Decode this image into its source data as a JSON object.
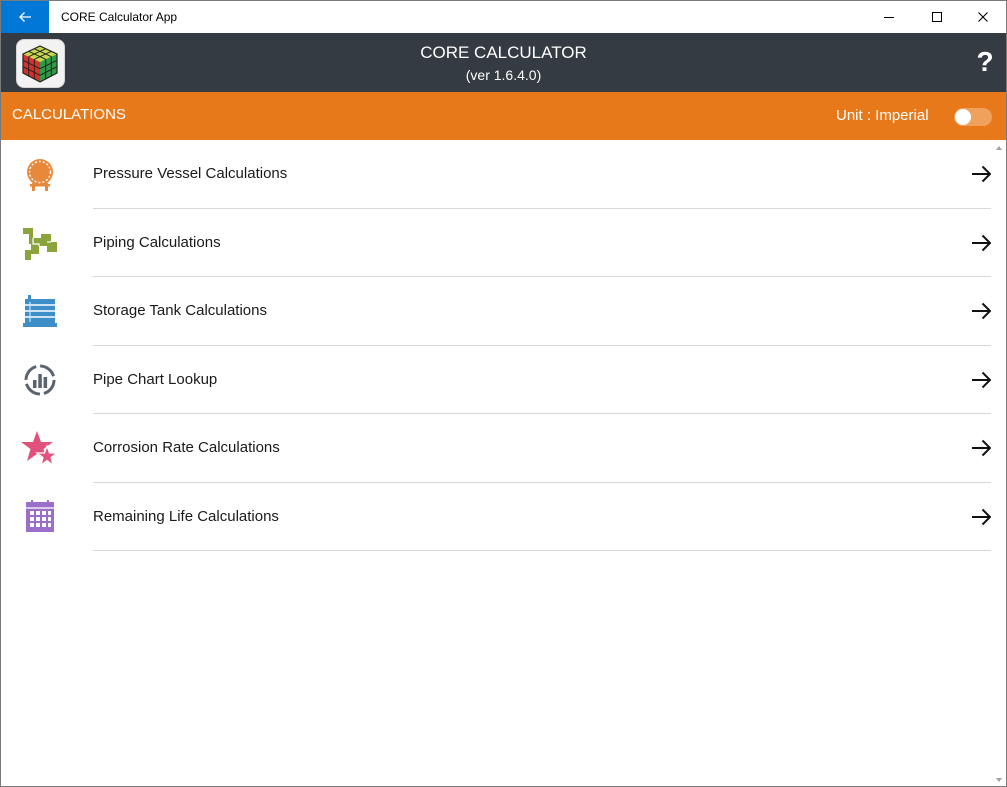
{
  "window": {
    "title": "CORE Calculator App",
    "icons": {
      "back": "back-arrow-icon",
      "minimize": "minimize-icon",
      "maximize": "maximize-icon",
      "close": "close-icon"
    },
    "accent_color": "#0078d7"
  },
  "header": {
    "title": "CORE CALCULATOR",
    "version": "(ver 1.6.4.0)",
    "help_label": "?",
    "logo_icon": "rubiks-cube-logo-icon",
    "background_color": "#353b43"
  },
  "section": {
    "title": "CALCULATIONS",
    "unit_label": "Unit : Imperial",
    "unit_toggle_on": false,
    "background_color": "#e8791a"
  },
  "items": [
    {
      "label": "Pressure Vessel Calculations",
      "icon": "pressure-vessel-icon",
      "color": "#e8883a"
    },
    {
      "label": "Piping Calculations",
      "icon": "piping-icon",
      "color": "#8aa33a"
    },
    {
      "label": "Storage Tank Calculations",
      "icon": "storage-tank-icon",
      "color": "#3d8ec9"
    },
    {
      "label": "Pipe Chart Lookup",
      "icon": "pipe-chart-icon",
      "color": "#5a6470"
    },
    {
      "label": "Corrosion Rate Calculations",
      "icon": "corrosion-star-icon",
      "color": "#e0527a"
    },
    {
      "label": "Remaining Life Calculations",
      "icon": "calendar-icon",
      "color": "#9b6fc9"
    }
  ]
}
